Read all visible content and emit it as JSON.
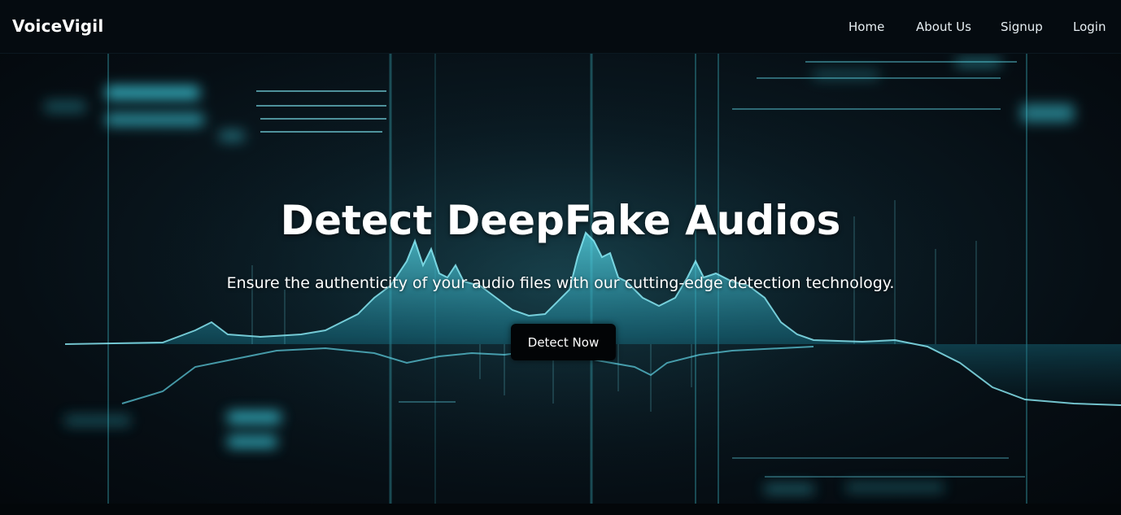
{
  "brand": {
    "name": "VoiceVigil"
  },
  "nav": {
    "items": [
      {
        "label": "Home"
      },
      {
        "label": "About Us"
      },
      {
        "label": "Signup"
      },
      {
        "label": "Login"
      }
    ]
  },
  "hero": {
    "title": "Detect DeepFake Audios",
    "subtitle": "Ensure the authenticity of your audio files with our cutting-edge detection technology.",
    "cta_label": "Detect Now"
  },
  "colors": {
    "accent": "#3fd6e8",
    "background": "#05080c",
    "button": "#020406"
  }
}
